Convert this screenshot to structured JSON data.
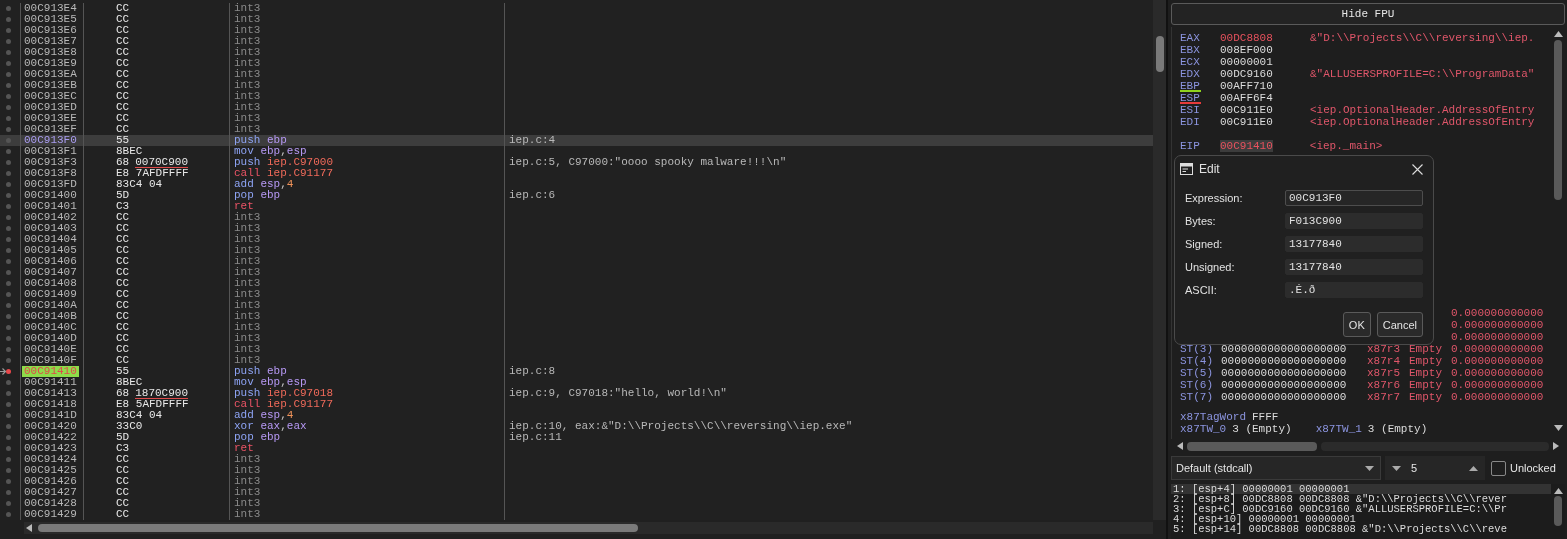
{
  "disassembly": {
    "rows": [
      {
        "address": "00C913E4",
        "bytes": "CC",
        "mnemonic": "int3",
        "kind": "filler",
        "operands": [],
        "selected": false,
        "breakpoint": false,
        "eip": false
      },
      {
        "address": "00C913E5",
        "bytes": "CC",
        "mnemonic": "int3",
        "kind": "filler",
        "operands": [],
        "selected": false,
        "breakpoint": false,
        "eip": false
      },
      {
        "address": "00C913E6",
        "bytes": "CC",
        "mnemonic": "int3",
        "kind": "filler",
        "operands": [],
        "selected": false,
        "breakpoint": false,
        "eip": false
      },
      {
        "address": "00C913E7",
        "bytes": "CC",
        "mnemonic": "int3",
        "kind": "filler",
        "operands": [],
        "selected": false,
        "breakpoint": false,
        "eip": false
      },
      {
        "address": "00C913E8",
        "bytes": "CC",
        "mnemonic": "int3",
        "kind": "filler",
        "operands": [],
        "selected": false,
        "breakpoint": false,
        "eip": false
      },
      {
        "address": "00C913E9",
        "bytes": "CC",
        "mnemonic": "int3",
        "kind": "filler",
        "operands": [],
        "selected": false,
        "breakpoint": false,
        "eip": false
      },
      {
        "address": "00C913EA",
        "bytes": "CC",
        "mnemonic": "int3",
        "kind": "filler",
        "operands": [],
        "selected": false,
        "breakpoint": false,
        "eip": false
      },
      {
        "address": "00C913EB",
        "bytes": "CC",
        "mnemonic": "int3",
        "kind": "filler",
        "operands": [],
        "selected": false,
        "breakpoint": false,
        "eip": false
      },
      {
        "address": "00C913EC",
        "bytes": "CC",
        "mnemonic": "int3",
        "kind": "filler",
        "operands": [],
        "selected": false,
        "breakpoint": false,
        "eip": false
      },
      {
        "address": "00C913ED",
        "bytes": "CC",
        "mnemonic": "int3",
        "kind": "filler",
        "operands": [],
        "selected": false,
        "breakpoint": false,
        "eip": false
      },
      {
        "address": "00C913EE",
        "bytes": "CC",
        "mnemonic": "int3",
        "kind": "filler",
        "operands": [],
        "selected": false,
        "breakpoint": false,
        "eip": false
      },
      {
        "address": "00C913EF",
        "bytes": "CC",
        "mnemonic": "int3",
        "kind": "filler",
        "operands": [],
        "selected": false,
        "breakpoint": false,
        "eip": false
      },
      {
        "address": "00C913F0",
        "bytes": "55",
        "mnemonic": "push",
        "kind": "normal",
        "operands": [
          {
            "text": "ebp",
            "kind": "reg"
          }
        ],
        "comment": "iep.c:4",
        "selected": true,
        "breakpoint": false,
        "eip": false
      },
      {
        "address": "00C913F1",
        "bytes": "8BEC",
        "mnemonic": "mov",
        "kind": "normal",
        "operands": [
          {
            "text": "ebp",
            "kind": "reg"
          },
          {
            "text": ",",
            "kind": "punct"
          },
          {
            "text": "esp",
            "kind": "reg"
          }
        ],
        "selected": false,
        "breakpoint": false,
        "eip": false
      },
      {
        "address": "00C913F3",
        "bytes": "68",
        "bytes_ref": "0070C900",
        "mnemonic": "push",
        "kind": "normal",
        "operands": [
          {
            "text": "iep.C97000",
            "kind": "addr"
          }
        ],
        "comment": "iep.c:5, C97000:\"oooo spooky malware!!!\\n\"",
        "selected": false,
        "breakpoint": false,
        "eip": false
      },
      {
        "address": "00C913F8",
        "bytes": "E8 7AFDFFFF",
        "mnemonic": "call",
        "kind": "flow",
        "operands": [
          {
            "text": "iep.C91177",
            "kind": "addr"
          }
        ],
        "selected": false,
        "breakpoint": false,
        "eip": false
      },
      {
        "address": "00C913FD",
        "bytes": "83C4 04",
        "mnemonic": "add",
        "kind": "normal",
        "operands": [
          {
            "text": "esp",
            "kind": "reg"
          },
          {
            "text": ",",
            "kind": "punct"
          },
          {
            "text": "4",
            "kind": "num"
          }
        ],
        "selected": false,
        "breakpoint": false,
        "eip": false
      },
      {
        "address": "00C91400",
        "bytes": "5D",
        "mnemonic": "pop",
        "kind": "normal",
        "operands": [
          {
            "text": "ebp",
            "kind": "reg"
          }
        ],
        "comment": "iep.c:6",
        "selected": false,
        "breakpoint": false,
        "eip": false
      },
      {
        "address": "00C91401",
        "bytes": "C3",
        "mnemonic": "ret",
        "kind": "flow",
        "operands": [],
        "selected": false,
        "breakpoint": false,
        "eip": false
      },
      {
        "address": "00C91402",
        "bytes": "CC",
        "mnemonic": "int3",
        "kind": "filler",
        "operands": [],
        "selected": false,
        "breakpoint": false,
        "eip": false
      },
      {
        "address": "00C91403",
        "bytes": "CC",
        "mnemonic": "int3",
        "kind": "filler",
        "operands": [],
        "selected": false,
        "breakpoint": false,
        "eip": false
      },
      {
        "address": "00C91404",
        "bytes": "CC",
        "mnemonic": "int3",
        "kind": "filler",
        "operands": [],
        "selected": false,
        "breakpoint": false,
        "eip": false
      },
      {
        "address": "00C91405",
        "bytes": "CC",
        "mnemonic": "int3",
        "kind": "filler",
        "operands": [],
        "selected": false,
        "breakpoint": false,
        "eip": false
      },
      {
        "address": "00C91406",
        "bytes": "CC",
        "mnemonic": "int3",
        "kind": "filler",
        "operands": [],
        "selected": false,
        "breakpoint": false,
        "eip": false
      },
      {
        "address": "00C91407",
        "bytes": "CC",
        "mnemonic": "int3",
        "kind": "filler",
        "operands": [],
        "selected": false,
        "breakpoint": false,
        "eip": false
      },
      {
        "address": "00C91408",
        "bytes": "CC",
        "mnemonic": "int3",
        "kind": "filler",
        "operands": [],
        "selected": false,
        "breakpoint": false,
        "eip": false
      },
      {
        "address": "00C91409",
        "bytes": "CC",
        "mnemonic": "int3",
        "kind": "filler",
        "operands": [],
        "selected": false,
        "breakpoint": false,
        "eip": false
      },
      {
        "address": "00C9140A",
        "bytes": "CC",
        "mnemonic": "int3",
        "kind": "filler",
        "operands": [],
        "selected": false,
        "breakpoint": false,
        "eip": false
      },
      {
        "address": "00C9140B",
        "bytes": "CC",
        "mnemonic": "int3",
        "kind": "filler",
        "operands": [],
        "selected": false,
        "breakpoint": false,
        "eip": false
      },
      {
        "address": "00C9140C",
        "bytes": "CC",
        "mnemonic": "int3",
        "kind": "filler",
        "operands": [],
        "selected": false,
        "breakpoint": false,
        "eip": false
      },
      {
        "address": "00C9140D",
        "bytes": "CC",
        "mnemonic": "int3",
        "kind": "filler",
        "operands": [],
        "selected": false,
        "breakpoint": false,
        "eip": false
      },
      {
        "address": "00C9140E",
        "bytes": "CC",
        "mnemonic": "int3",
        "kind": "filler",
        "operands": [],
        "selected": false,
        "breakpoint": false,
        "eip": false
      },
      {
        "address": "00C9140F",
        "bytes": "CC",
        "mnemonic": "int3",
        "kind": "filler",
        "operands": [],
        "selected": false,
        "breakpoint": false,
        "eip": false
      },
      {
        "address": "00C91410",
        "bytes": "55",
        "mnemonic": "push",
        "kind": "normal",
        "operands": [
          {
            "text": "ebp",
            "kind": "reg"
          }
        ],
        "comment": "iep.c:8",
        "selected": false,
        "breakpoint": true,
        "eip": true
      },
      {
        "address": "00C91411",
        "bytes": "8BEC",
        "mnemonic": "mov",
        "kind": "normal",
        "operands": [
          {
            "text": "ebp",
            "kind": "reg"
          },
          {
            "text": ",",
            "kind": "punct"
          },
          {
            "text": "esp",
            "kind": "reg"
          }
        ],
        "selected": false,
        "breakpoint": false,
        "eip": false
      },
      {
        "address": "00C91413",
        "bytes": "68",
        "bytes_ref": "1870C900",
        "mnemonic": "push",
        "kind": "normal",
        "operands": [
          {
            "text": "iep.C97018",
            "kind": "addr"
          }
        ],
        "comment": "iep.c:9, C97018:\"hello, world!\\n\"",
        "selected": false,
        "breakpoint": false,
        "eip": false
      },
      {
        "address": "00C91418",
        "bytes": "E8 5AFDFFFF",
        "mnemonic": "call",
        "kind": "flow",
        "operands": [
          {
            "text": "iep.C91177",
            "kind": "addr"
          }
        ],
        "selected": false,
        "breakpoint": false,
        "eip": false
      },
      {
        "address": "00C9141D",
        "bytes": "83C4 04",
        "mnemonic": "add",
        "kind": "normal",
        "operands": [
          {
            "text": "esp",
            "kind": "reg"
          },
          {
            "text": ",",
            "kind": "punct"
          },
          {
            "text": "4",
            "kind": "num"
          }
        ],
        "selected": false,
        "breakpoint": false,
        "eip": false
      },
      {
        "address": "00C91420",
        "bytes": "33C0",
        "mnemonic": "xor",
        "kind": "normal",
        "operands": [
          {
            "text": "eax",
            "kind": "reg"
          },
          {
            "text": ",",
            "kind": "punct"
          },
          {
            "text": "eax",
            "kind": "reg"
          }
        ],
        "comment": "iep.c:10, eax:&\"D:\\\\Projects\\\\C\\\\reversing\\\\iep.exe\"",
        "selected": false,
        "breakpoint": false,
        "eip": false
      },
      {
        "address": "00C91422",
        "bytes": "5D",
        "mnemonic": "pop",
        "kind": "normal",
        "operands": [
          {
            "text": "ebp",
            "kind": "reg"
          }
        ],
        "comment": "iep.c:11",
        "selected": false,
        "breakpoint": false,
        "eip": false
      },
      {
        "address": "00C91423",
        "bytes": "C3",
        "mnemonic": "ret",
        "kind": "flow",
        "operands": [],
        "selected": false,
        "breakpoint": false,
        "eip": false
      },
      {
        "address": "00C91424",
        "bytes": "CC",
        "mnemonic": "int3",
        "kind": "filler",
        "operands": [],
        "selected": false,
        "breakpoint": false,
        "eip": false
      },
      {
        "address": "00C91425",
        "bytes": "CC",
        "mnemonic": "int3",
        "kind": "filler",
        "operands": [],
        "selected": false,
        "breakpoint": false,
        "eip": false
      },
      {
        "address": "00C91426",
        "bytes": "CC",
        "mnemonic": "int3",
        "kind": "filler",
        "operands": [],
        "selected": false,
        "breakpoint": false,
        "eip": false
      },
      {
        "address": "00C91427",
        "bytes": "CC",
        "mnemonic": "int3",
        "kind": "filler",
        "operands": [],
        "selected": false,
        "breakpoint": false,
        "eip": false
      },
      {
        "address": "00C91428",
        "bytes": "CC",
        "mnemonic": "int3",
        "kind": "filler",
        "operands": [],
        "selected": false,
        "breakpoint": false,
        "eip": false
      },
      {
        "address": "00C91429",
        "bytes": "CC",
        "mnemonic": "int3",
        "kind": "filler",
        "operands": [],
        "selected": false,
        "breakpoint": false,
        "eip": false
      }
    ]
  },
  "registers": {
    "toggle_button": "Hide FPU",
    "rows": [
      {
        "name": "EAX",
        "value": "00DC8808",
        "comment": "&\"D:\\\\Projects\\\\C\\\\reversing\\\\iep.",
        "changed": true,
        "selected": false
      },
      {
        "name": "EBX",
        "value": "008EF000",
        "changed": false,
        "selected": false
      },
      {
        "name": "ECX",
        "value": "00000001",
        "changed": false,
        "selected": false
      },
      {
        "name": "EDX",
        "value": "00DC9160",
        "comment": "&\"ALLUSERSPROFILE=C:\\\\ProgramData\"",
        "changed": false,
        "selected": false
      },
      {
        "name": "EBP",
        "value": "00AFF710",
        "color": "#8fd21e",
        "changed": false,
        "selected": false
      },
      {
        "name": "ESP",
        "value": "00AFF6F4",
        "color": "#e53a3a",
        "changed": false,
        "selected": false
      },
      {
        "name": "ESI",
        "value": "00C911E0",
        "comment": "<iep.OptionalHeader.AddressOfEntry",
        "changed": false,
        "selected": false
      },
      {
        "name": "EDI",
        "value": "00C911E0",
        "comment": "<iep.OptionalHeader.AddressOfEntry",
        "changed": false,
        "selected": false
      }
    ],
    "instruction_pointer": {
      "name": "EIP",
      "value": "00C91410",
      "comment": "<iep._main>",
      "changed": true,
      "selected": true
    },
    "fpu_rows": [
      {
        "value": "0.000000000000"
      },
      {
        "value": "0.000000000000"
      },
      {
        "value": "0.000000000000"
      },
      {
        "name": "ST(3)",
        "raw": "0000000000000000000",
        "tag_reg": "x87r3",
        "tag": "Empty",
        "value": "0.000000000000"
      },
      {
        "name": "ST(4)",
        "raw": "0000000000000000000",
        "tag_reg": "x87r4",
        "tag": "Empty",
        "value": "0.000000000000"
      },
      {
        "name": "ST(5)",
        "raw": "0000000000000000000",
        "tag_reg": "x87r5",
        "tag": "Empty",
        "value": "0.000000000000"
      },
      {
        "name": "ST(6)",
        "raw": "0000000000000000000",
        "tag_reg": "x87r6",
        "tag": "Empty",
        "value": "0.000000000000"
      },
      {
        "name": "ST(7)",
        "raw": "0000000000000000000",
        "tag_reg": "x87r7",
        "tag": "Empty",
        "value": "0.000000000000"
      }
    ],
    "tag_word": {
      "name": "x87TagWord",
      "value": "FFFF"
    },
    "tag_entries": [
      {
        "name": "x87TW_0",
        "value": "3 (Empty)"
      },
      {
        "name": "x87TW_1",
        "value": "3 (Empty)"
      }
    ]
  },
  "edit_dialog": {
    "title": "Edit",
    "fields": [
      {
        "label": "Expression:",
        "value": "00C913F0",
        "focused": true
      },
      {
        "label": "Bytes:",
        "value": "F013C900",
        "focused": false
      },
      {
        "label": "Signed:",
        "value": "13177840",
        "focused": false
      },
      {
        "label": "Unsigned:",
        "value": "13177840",
        "focused": false
      },
      {
        "label": "ASCII:",
        "value": ".É.ð",
        "focused": false
      }
    ],
    "buttons": [
      "OK",
      "Cancel"
    ]
  },
  "call_stack_args": {
    "convention": "Default (stdcall)",
    "count": "5",
    "lock_label": "Unlocked",
    "locked": false,
    "rows": [
      {
        "text": "1: [esp+4] 00000001 00000001",
        "selected": true
      },
      {
        "text": "2: [esp+8] 00DC8808 00DC8808 &\"D:\\\\Projects\\\\C\\\\rever",
        "selected": false
      },
      {
        "text": "3: [esp+C] 00DC9160 00DC9160 &\"ALLUSERSPROFILE=C:\\\\Pr",
        "selected": false
      },
      {
        "text": "4: [esp+10] 00000001 00000001",
        "selected": false
      },
      {
        "text": "5: [esp+14] 00DC8808 00DC8808 &\"D:\\\\Projects\\\\C\\\\reve",
        "selected": false
      }
    ]
  }
}
